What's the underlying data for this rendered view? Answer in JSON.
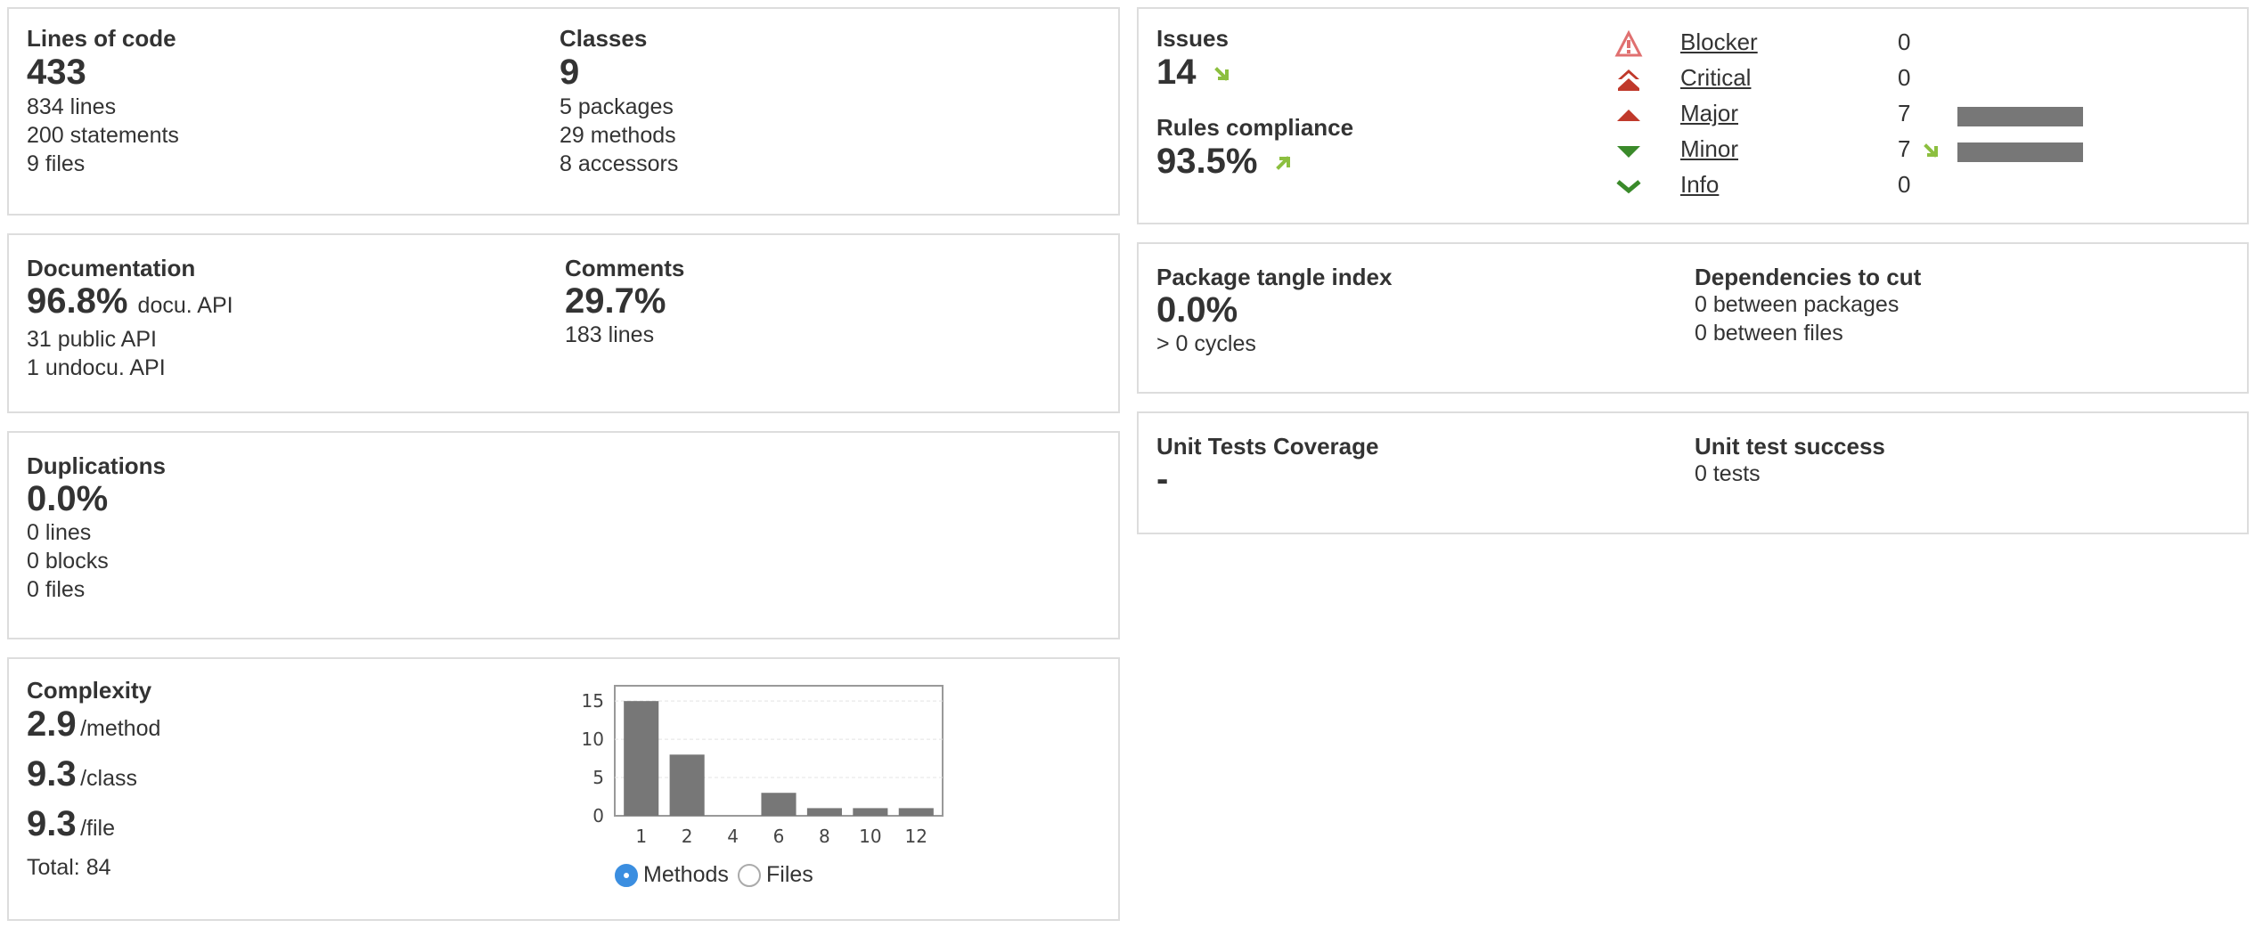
{
  "size": {
    "title": "Lines of code",
    "value": "433",
    "lines": [
      "834 lines",
      "200 statements",
      "9 files"
    ]
  },
  "classes": {
    "title": "Classes",
    "value": "9",
    "lines": [
      "5 packages",
      "29 methods",
      "8 accessors"
    ]
  },
  "documentation": {
    "title": "Documentation",
    "value": "96.8%",
    "unit": "docu. API",
    "lines": [
      "31 public API",
      "1 undocu. API"
    ]
  },
  "comments": {
    "title": "Comments",
    "value": "29.7%",
    "lines": [
      "183 lines"
    ]
  },
  "duplications": {
    "title": "Duplications",
    "value": "0.0%",
    "lines": [
      "0 lines",
      "0 blocks",
      "0 files"
    ]
  },
  "complexity": {
    "title": "Complexity",
    "per_method": {
      "value": "2.9",
      "unit": "/method"
    },
    "per_class": {
      "value": "9.3",
      "unit": "/class"
    },
    "per_file": {
      "value": "9.3",
      "unit": "/file"
    },
    "total": "Total: 84",
    "toggle": {
      "methods": "Methods",
      "files": "Files",
      "selected": "Methods"
    }
  },
  "chart_data": {
    "type": "bar",
    "categories": [
      "1",
      "2",
      "4",
      "6",
      "8",
      "10",
      "12"
    ],
    "values": [
      15,
      8,
      0,
      3,
      1,
      1,
      1
    ],
    "yticks": [
      0,
      5,
      10,
      15
    ],
    "ylim": [
      0,
      17
    ],
    "grid": true
  },
  "issues": {
    "title": "Issues",
    "value": "14",
    "trend_color": "#8cbf3f",
    "severities": [
      {
        "name": "Blocker",
        "icon": "blocker-icon",
        "count": "0",
        "bar": 0
      },
      {
        "name": "Critical",
        "icon": "critical-icon",
        "count": "0",
        "bar": 0
      },
      {
        "name": "Major",
        "icon": "major-icon",
        "count": "7",
        "bar": 1
      },
      {
        "name": "Minor",
        "icon": "minor-icon",
        "count": "7",
        "bar": 1,
        "trend": true
      },
      {
        "name": "Info",
        "icon": "info-icon",
        "count": "0",
        "bar": 0
      }
    ]
  },
  "rules": {
    "title": "Rules compliance",
    "value": "93.5%"
  },
  "tangle": {
    "title": "Package tangle index",
    "value": "0.0%",
    "lines": [
      "> 0 cycles"
    ]
  },
  "dependencies": {
    "title": "Dependencies to cut",
    "lines": [
      "0 between packages",
      "0 between files"
    ]
  },
  "coverage": {
    "title": "Unit Tests Coverage",
    "value": "-"
  },
  "test_success": {
    "title": "Unit test success",
    "lines": [
      "0 tests"
    ]
  },
  "colors": {
    "blocker": "#e07070",
    "critical": "#c0392b",
    "major": "#c0392b",
    "minor": "#3a8a2a",
    "info": "#3a8a2a",
    "bar": "#777777",
    "radio": "#3b8ee0"
  }
}
